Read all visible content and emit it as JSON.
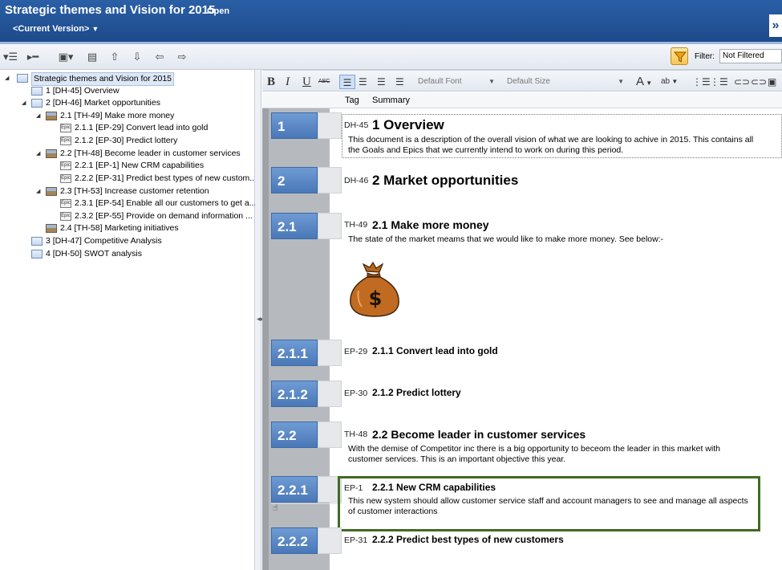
{
  "header": {
    "title": "Strategic themes and Vision for 2015",
    "status": "Open",
    "version": "<Current Version>"
  },
  "toolbar": {
    "filter_label": "Filter:",
    "filter_value": "Not Filtered"
  },
  "format_bar": {
    "bold": "B",
    "italic": "I",
    "underline": "U",
    "strike": "ABC",
    "font": "Default Font",
    "size": "Default Size",
    "font_color_glyph": "A",
    "highlight_glyph": "ab"
  },
  "columns": {
    "tag": "Tag",
    "summary": "Summary"
  },
  "tree": {
    "root": "Strategic themes and Vision for 2015",
    "items": [
      {
        "label": "1 [DH-45] Overview"
      },
      {
        "label": "2 [DH-46] Market opportunities"
      },
      {
        "label": "2.1 [TH-49] Make more money"
      },
      {
        "label": "2.1.1 [EP-29] Convert lead into gold"
      },
      {
        "label": "2.1.2 [EP-30] Predict lottery"
      },
      {
        "label": "2.2 [TH-48] Become leader in customer services"
      },
      {
        "label": "2.2.1 [EP-1] New CRM capabilities"
      },
      {
        "label": "2.2.2 [EP-31] Predict best types of new custom..."
      },
      {
        "label": "2.3 [TH-53] Increase customer retention"
      },
      {
        "label": "2.3.1 [EP-54] Enable all our customers to get a..."
      },
      {
        "label": "2.3.2 [EP-55] Provide on demand information ..."
      },
      {
        "label": "2.4 [TH-58] Marketing initiatives"
      },
      {
        "label": "3 [DH-47] Competitive Analysis"
      },
      {
        "label": "4 [DH-50] SWOT analysis"
      }
    ]
  },
  "document": {
    "rows": [
      {
        "number": "1",
        "tag": "DH-45",
        "title": "1  Overview",
        "desc": "This document is a description of the overall vision of what we are looking to achive in 2015. This contains all the Goals and Epics that we currently intend to work on during this period."
      },
      {
        "number": "2",
        "tag": "DH-46",
        "title": "2  Market opportunities"
      },
      {
        "number": "2.1",
        "tag": "TH-49",
        "title": "2.1  Make more money",
        "desc": "The state of the market meams that we would like to make more money. See below:-"
      },
      {
        "number": "2.1.1",
        "tag": "EP-29",
        "title": "2.1.1  Convert lead into gold"
      },
      {
        "number": "2.1.2",
        "tag": "EP-30",
        "title": "2.1.2  Predict lottery"
      },
      {
        "number": "2.2",
        "tag": "TH-48",
        "title": "2.2  Become leader in customer services",
        "desc": "With the demise of Competitor inc there is a big opportunity to beceom the leader in this market with customer services. This is an important objective this year."
      },
      {
        "number": "2.2.1",
        "tag": "EP-1",
        "title": "2.2.1  New CRM capabilities",
        "desc": "This new system should allow customer service staff and account managers to see and manage all aspects of customer interactions"
      },
      {
        "number": "2.2.2",
        "tag": "EP-31",
        "title": "2.2.2  Predict best types of new customers"
      }
    ],
    "image_glyph": "$"
  }
}
